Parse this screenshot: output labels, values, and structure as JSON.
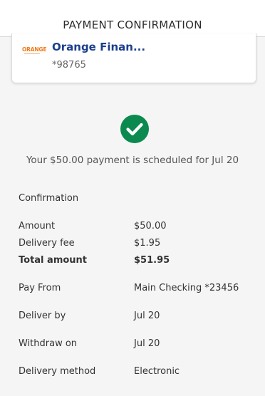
{
  "header": {
    "title": "PAYMENT CONFIRMATION"
  },
  "payee": {
    "name": "Orange Finan...",
    "account": "*98765",
    "logo_text": "ORANGE",
    "brand_color": "#1c3f8c",
    "logo_color": "#f07a1a"
  },
  "status": {
    "icon": "check-circle-icon",
    "icon_color": "#0b8a4f",
    "message": "Your $50.00 payment is scheduled for Jul 20"
  },
  "details": {
    "section_title": "Confirmation",
    "amount": {
      "label": "Amount",
      "value": "$50.00"
    },
    "delivery_fee": {
      "label": "Delivery fee",
      "value": "$1.95"
    },
    "total": {
      "label": "Total amount",
      "value": "$51.95"
    },
    "pay_from": {
      "label": "Pay From",
      "value": "Main Checking *23456"
    },
    "deliver_by": {
      "label": "Deliver by",
      "value": "Jul 20"
    },
    "withdraw_on": {
      "label": "Withdraw on",
      "value": "Jul 20"
    },
    "delivery_method": {
      "label": "Delivery method",
      "value": "Electronic"
    }
  }
}
